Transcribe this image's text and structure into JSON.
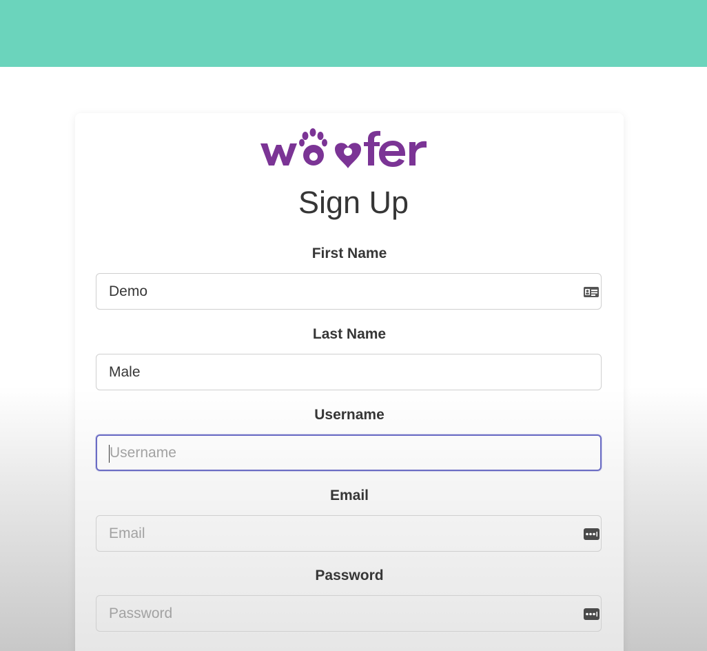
{
  "header": {
    "bar_color": "#6bd4bc"
  },
  "logo": {
    "text": "woofer",
    "color": "#7b3495"
  },
  "form": {
    "title": "Sign Up",
    "fields": [
      {
        "label": "First Name",
        "value": "Demo",
        "placeholder": "",
        "icon": "id-card-icon"
      },
      {
        "label": "Last Name",
        "value": "Male",
        "placeholder": "",
        "icon": ""
      },
      {
        "label": "Username",
        "value": "",
        "placeholder": "Username",
        "icon": "",
        "focused": true
      },
      {
        "label": "Email",
        "value": "",
        "placeholder": "Email",
        "icon": "password-manager-icon"
      },
      {
        "label": "Password",
        "value": "",
        "placeholder": "Password",
        "icon": "password-manager-icon"
      }
    ]
  },
  "colors": {
    "accent_focus": "#6a6cc4",
    "text": "#363636",
    "placeholder": "#a2a2a2"
  }
}
